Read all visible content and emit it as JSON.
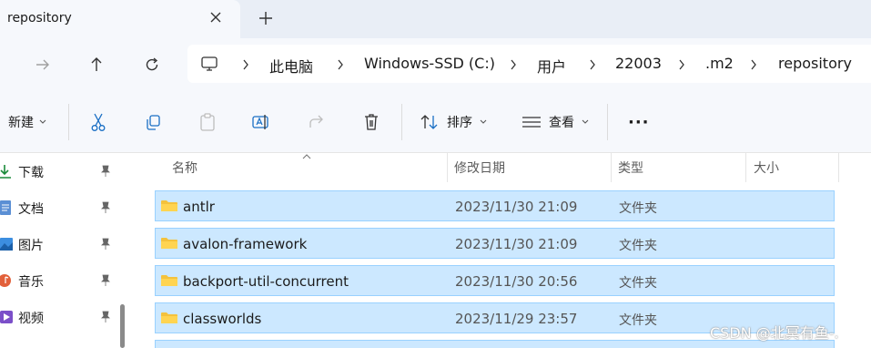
{
  "tab": {
    "title": "repository"
  },
  "breadcrumbs": [
    "此电脑",
    "Windows-SSD (C:)",
    "用户",
    "22003",
    ".m2",
    "repository"
  ],
  "toolbar": {
    "new_label": "新建",
    "sort_label": "排序",
    "view_label": "查看",
    "more_label": "···"
  },
  "sidebar": {
    "items": [
      {
        "label": "下载",
        "icon": "download-icon"
      },
      {
        "label": "文档",
        "icon": "document-icon"
      },
      {
        "label": "图片",
        "icon": "picture-icon"
      },
      {
        "label": "音乐",
        "icon": "music-icon"
      },
      {
        "label": "视频",
        "icon": "video-icon"
      }
    ]
  },
  "columns": {
    "name": "名称",
    "modified": "修改日期",
    "type": "类型",
    "size": "大小"
  },
  "files": [
    {
      "name": "antlr",
      "modified": "2023/11/30 21:09",
      "type": "文件夹"
    },
    {
      "name": "avalon-framework",
      "modified": "2023/11/30 21:09",
      "type": "文件夹"
    },
    {
      "name": "backport-util-concurrent",
      "modified": "2023/11/30 20:56",
      "type": "文件夹"
    },
    {
      "name": "classworlds",
      "modified": "2023/11/29 23:57",
      "type": "文件夹"
    }
  ],
  "watermark": "CSDN @北冥有鱼-.",
  "colors": {
    "selection": "#cce8ff",
    "selection_border": "#99d1ff",
    "folder": "#f4c23d",
    "accent": "#0067c0"
  }
}
